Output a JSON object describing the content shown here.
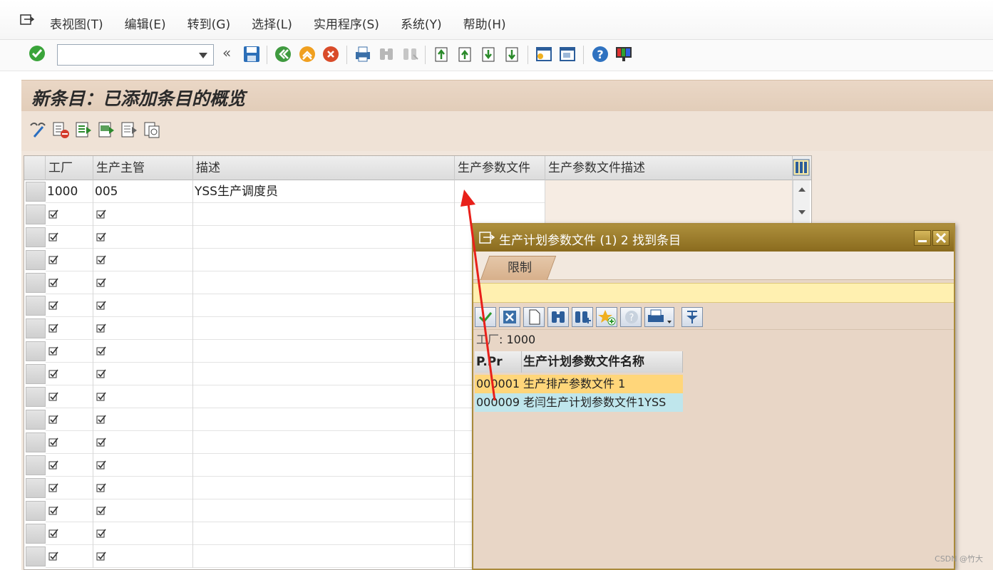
{
  "menubar": {
    "items": [
      "表视图(T)",
      "编辑(E)",
      "转到(G)",
      "选择(L)",
      "实用程序(S)",
      "系统(Y)",
      "帮助(H)"
    ]
  },
  "toolbar": {
    "command_value": "",
    "icons": [
      "enter-icon",
      "back-icon",
      "save-icon",
      "back-nav-icon",
      "exit-icon",
      "cancel-icon",
      "print-icon",
      "find-icon",
      "find-next-icon",
      "first-page-icon",
      "prev-page-icon",
      "next-page-icon",
      "last-page-icon",
      "new-session-icon",
      "shortcut-icon",
      "help-icon",
      "layout-icon"
    ]
  },
  "screen": {
    "title": "新条目：已添加条目的概览"
  },
  "table": {
    "columns": [
      "工厂",
      "生产主管",
      "描述",
      "生产参数文件",
      "生产参数文件描述"
    ],
    "first_row": {
      "plant": "1000",
      "supervisor": "005",
      "description": "YSS生产调度员",
      "profile": "",
      "profile_desc": ""
    },
    "empty_row_count": 16
  },
  "popup": {
    "title": "生产计划参数文件 (1)    2 找到条目",
    "tab": "限制",
    "plant_label": "工厂",
    "plant_value": ": 1000",
    "columns": [
      "P.Pr",
      "生产计划参数文件名称"
    ],
    "rows": [
      {
        "code": "000001",
        "name": "生产排产参数文件 1"
      },
      {
        "code": "000009",
        "name": "老闫生产计划参数文件1YSS"
      }
    ]
  },
  "watermark": "CSDN @竹大",
  "colors": {
    "title_bg": "#e2cdb9",
    "popup_title": "#8a6b1e",
    "selected_row": "#ffd67a",
    "highlight_row": "#bfe6ec",
    "arrow": "#e8201a"
  }
}
